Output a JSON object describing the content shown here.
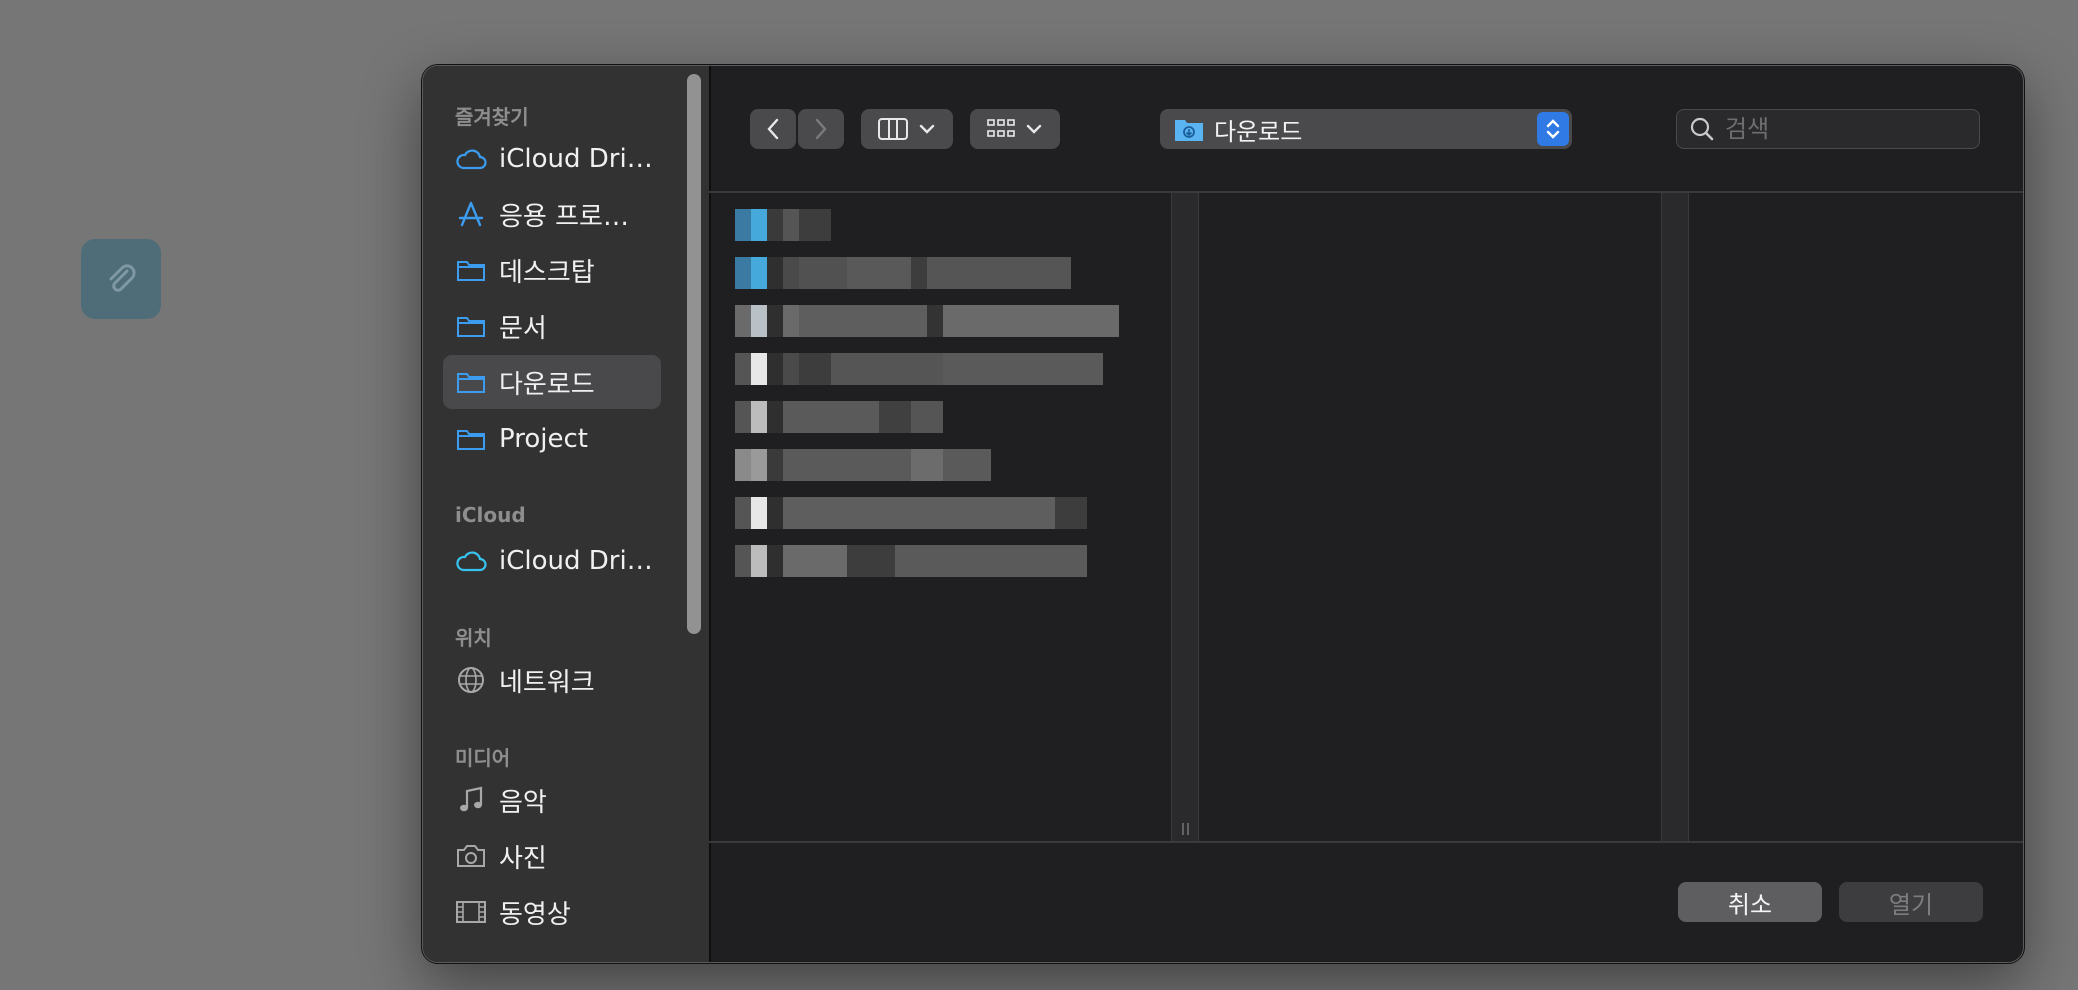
{
  "sidebar": {
    "sections": {
      "favorites": "즐겨찾기",
      "icloud": "iCloud",
      "locations": "위치",
      "media": "미디어"
    },
    "items": [
      {
        "label": "iCloud Dri…",
        "icon": "cloud-icon"
      },
      {
        "label": "응용 프로…",
        "icon": "applications-icon"
      },
      {
        "label": "데스크탑",
        "icon": "folder-icon"
      },
      {
        "label": "문서",
        "icon": "folder-icon"
      },
      {
        "label": "다운로드",
        "icon": "folder-icon",
        "selected": true
      },
      {
        "label": "Project",
        "icon": "folder-icon"
      },
      {
        "label": "iCloud Dri…",
        "icon": "cloud-icon"
      },
      {
        "label": "네트워크",
        "icon": "globe-icon"
      },
      {
        "label": "음악",
        "icon": "music-note-icon"
      },
      {
        "label": "사진",
        "icon": "camera-icon"
      },
      {
        "label": "동영상",
        "icon": "film-icon"
      }
    ]
  },
  "toolbar": {
    "path_label": "다운로드",
    "search_placeholder": "검색"
  },
  "footer": {
    "cancel_label": "취소",
    "open_label": "열기"
  },
  "colors": {
    "accent": "#2f7ae5",
    "sidebar_icon": "#3b9cf0",
    "dialog_bg": "#1f1e20",
    "sidebar_bg": "#323233"
  }
}
